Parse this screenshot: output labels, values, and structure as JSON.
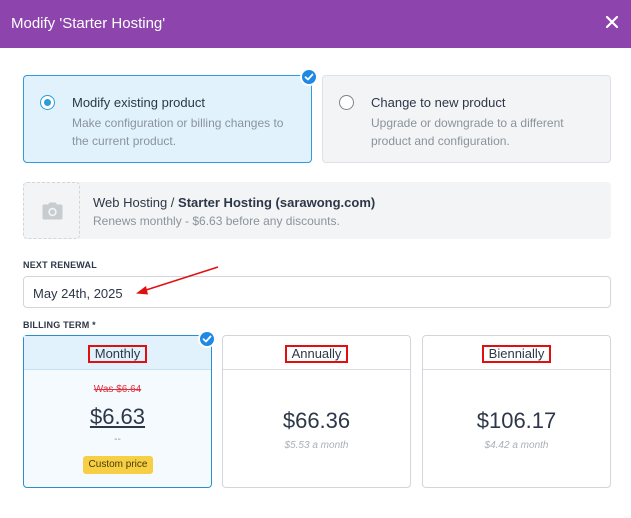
{
  "modal": {
    "title": "Modify 'Starter Hosting'",
    "close_icon": "close-icon"
  },
  "options": {
    "modify": {
      "title": "Modify existing product",
      "description": "Make configuration or billing changes to the current product.",
      "selected": true
    },
    "change": {
      "title": "Change to new product",
      "description": "Upgrade or downgrade to a different product and configuration.",
      "selected": false
    }
  },
  "product": {
    "image_icon": "camera-icon",
    "category": "Web Hosting",
    "separator": " / ",
    "name": "Starter Hosting (sarawong.com)",
    "renewal_note": "Renews monthly - $6.63 before any discounts."
  },
  "next_renewal": {
    "label": "NEXT RENEWAL",
    "value": "May 24th, 2025"
  },
  "billing_term": {
    "label": "BILLING TERM *",
    "terms": [
      {
        "name": "Monthly",
        "was_price": "Was $6.64",
        "price": "$6.63",
        "sub": "--",
        "badge": "Custom price",
        "selected": true
      },
      {
        "name": "Annually",
        "price": "$66.36",
        "per_month": "$5.53 a month",
        "selected": false
      },
      {
        "name": "Biennially",
        "price": "$106.17",
        "per_month": "$4.42 a month",
        "selected": false
      }
    ]
  },
  "colors": {
    "header": "#8e44ad",
    "accent": "#2f9bd8",
    "check_badge": "#1e88e5",
    "annotation": "#e01010",
    "custom_badge": "#f6cf45"
  }
}
